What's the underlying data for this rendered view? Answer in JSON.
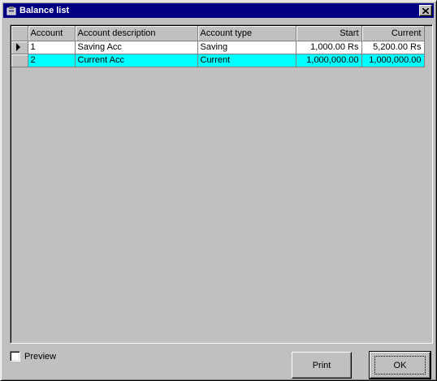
{
  "window": {
    "title": "Balance list",
    "title_icon": "app-icon",
    "close_icon": "close-icon"
  },
  "grid": {
    "columns": [
      "Account",
      "Account description",
      "Account type",
      "Start",
      "Current"
    ],
    "rows": [
      {
        "account": "1",
        "description": "Saving Acc",
        "type": "Saving",
        "start": "1,000.00 Rs",
        "current": "5,200.00 Rs",
        "highlight": false,
        "current_row": true
      },
      {
        "account": "2",
        "description": "Current Acc",
        "type": "Current",
        "start": "1,000,000.00",
        "current": "1,000,000.00",
        "highlight": true,
        "current_row": false
      }
    ],
    "highlight_color": "#00ffff"
  },
  "footer": {
    "preview_label": "Preview",
    "preview_checked": false,
    "print_label": "Print",
    "ok_label": "OK"
  }
}
